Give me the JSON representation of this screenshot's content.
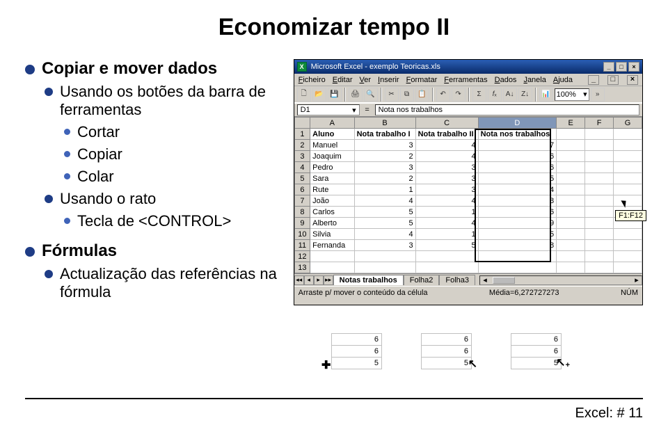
{
  "slide": {
    "title": "Economizar tempo II",
    "bullets": {
      "b1a": "Copiar e mover dados",
      "b2a": "Usando os botões da barra de ferramentas",
      "b3a": "Cortar",
      "b3b": "Copiar",
      "b3c": "Colar",
      "b2b": "Usando o rato",
      "b3d": "Tecla de <CONTROL>",
      "b1b": "Fórmulas",
      "b2c": "Actualização das referências na fórmula"
    },
    "footer": "Excel: # 11"
  },
  "excel": {
    "title": "Microsoft Excel - exemplo Teoricas.xls",
    "menus": [
      "Ficheiro",
      "Editar",
      "Ver",
      "Inserir",
      "Formatar",
      "Ferramentas",
      "Dados",
      "Janela",
      "Ajuda"
    ],
    "zoom": "100%",
    "namebox": "D1",
    "formula": "Nota nos trabalhos",
    "winbtns": {
      "min": "_",
      "max": "□",
      "close": "×"
    },
    "columns": [
      "",
      "A",
      "B",
      "C",
      "D",
      "E",
      "F",
      "G"
    ],
    "rows": [
      {
        "n": "1",
        "a": "Aluno",
        "b": "Nota trabalho I",
        "c": "Nota trabalho II",
        "d": "Nota nos trabalhos",
        "e": "",
        "f": "",
        "g": ""
      },
      {
        "n": "2",
        "a": "Manuel",
        "b": "3",
        "c": "4",
        "d": "7",
        "e": "",
        "f": "",
        "g": ""
      },
      {
        "n": "3",
        "a": "Joaquim",
        "b": "2",
        "c": "4",
        "d": "6",
        "e": "",
        "f": "",
        "g": ""
      },
      {
        "n": "4",
        "a": "Pedro",
        "b": "3",
        "c": "3",
        "d": "6",
        "e": "",
        "f": "",
        "g": ""
      },
      {
        "n": "5",
        "a": "Sara",
        "b": "2",
        "c": "3",
        "d": "5",
        "e": "",
        "f": "",
        "g": ""
      },
      {
        "n": "6",
        "a": "Rute",
        "b": "1",
        "c": "3",
        "d": "4",
        "e": "",
        "f": "",
        "g": ""
      },
      {
        "n": "7",
        "a": "João",
        "b": "4",
        "c": "4",
        "d": "8",
        "e": "",
        "f": "",
        "g": ""
      },
      {
        "n": "8",
        "a": "Carlos",
        "b": "5",
        "c": "1",
        "d": "6",
        "e": "",
        "f": "",
        "g": ""
      },
      {
        "n": "9",
        "a": "Alberto",
        "b": "5",
        "c": "4",
        "d": "9",
        "e": "",
        "f": "",
        "g": ""
      },
      {
        "n": "10",
        "a": "Silvia",
        "b": "4",
        "c": "1",
        "d": "5",
        "e": "",
        "f": "",
        "g": ""
      },
      {
        "n": "11",
        "a": "Fernanda",
        "b": "3",
        "c": "5",
        "d": "8",
        "e": "",
        "f": "",
        "g": ""
      },
      {
        "n": "12",
        "a": "",
        "b": "",
        "c": "",
        "d": "",
        "e": "",
        "f": "",
        "g": ""
      },
      {
        "n": "13",
        "a": "",
        "b": "",
        "c": "",
        "d": "",
        "e": "",
        "f": "",
        "g": ""
      }
    ],
    "tabs": {
      "nav": [
        "◂◂",
        "◂",
        "▸",
        "▸▸"
      ],
      "sheets": [
        "Notas trabalhos",
        "Folha2",
        "Folha3"
      ]
    },
    "status": {
      "left": "Arraste p/ mover o conteúdo da célula",
      "mid": "Média=6,272727273",
      "right": "NÚM"
    },
    "tooltip": "F1:F12"
  },
  "mini": {
    "cursor1": "✚",
    "arrow_plain": "↖",
    "arrow_plus": "↖₊",
    "vals1": [
      "6",
      "6",
      "5"
    ],
    "vals2": [
      "6",
      "6",
      "5"
    ],
    "vals3": [
      "6",
      "6",
      "5"
    ]
  }
}
